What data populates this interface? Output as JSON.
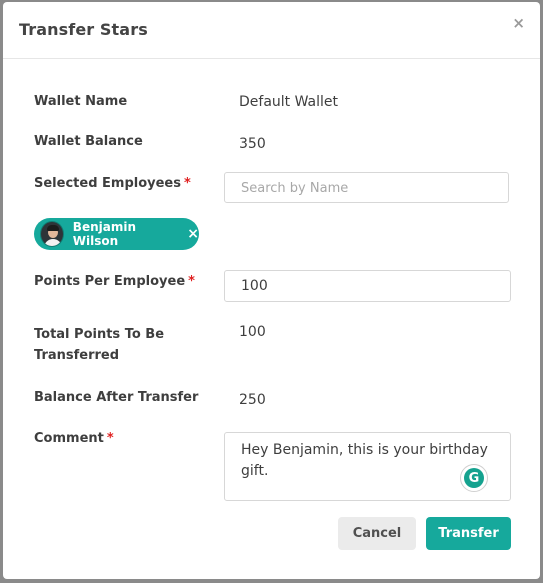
{
  "modal": {
    "title": "Transfer Stars",
    "close_glyph": "×",
    "close_icon": "close-icon"
  },
  "form": {
    "wallet_name_label": "Wallet Name",
    "wallet_name_value": "Default Wallet",
    "wallet_balance_label": "Wallet Balance",
    "wallet_balance_value": "350",
    "selected_employees_label": "Selected Employees",
    "required_mark": "*",
    "search_placeholder": "Search by Name",
    "selected_employee": {
      "name": "Benjamin Wilson",
      "remove_glyph": "×",
      "remove_icon": "close-icon",
      "avatar_icon": "avatar"
    },
    "points_per_employee_label": "Points Per Employee",
    "points_per_employee_value": "100",
    "total_points_label": "Total Points To Be Transferred",
    "total_points_value": "100",
    "balance_after_label": "Balance After Transfer",
    "balance_after_value": "250",
    "comment_label": "Comment",
    "comment_value": "Hey Benjamin, this is your birthday gift.",
    "grammarly_glyph": "G",
    "grammarly_icon": "grammarly-icon"
  },
  "actions": {
    "cancel_label": "Cancel",
    "transfer_label": "Transfer"
  },
  "colors": {
    "accent": "#16a99c",
    "required": "#e02020",
    "backdrop": "#8a8a8a"
  }
}
